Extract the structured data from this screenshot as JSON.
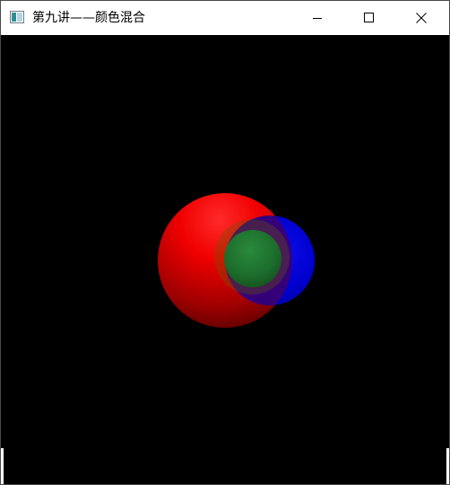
{
  "window": {
    "title": "第九讲——颜色混合",
    "app_icon": "opengl-window-icon",
    "controls": {
      "minimize_icon": "minimize-icon",
      "maximize_icon": "maximize-icon",
      "close_icon": "close-icon"
    }
  },
  "scene": {
    "background_color": "#000000",
    "objects": [
      {
        "name": "red-sphere",
        "color": "#ff0000",
        "opacity": 1.0
      },
      {
        "name": "blue-sphere",
        "color": "#0000ff",
        "opacity": 0.55
      },
      {
        "name": "green-sphere",
        "color": "#1e7a2e",
        "opacity": 0.8
      }
    ]
  }
}
